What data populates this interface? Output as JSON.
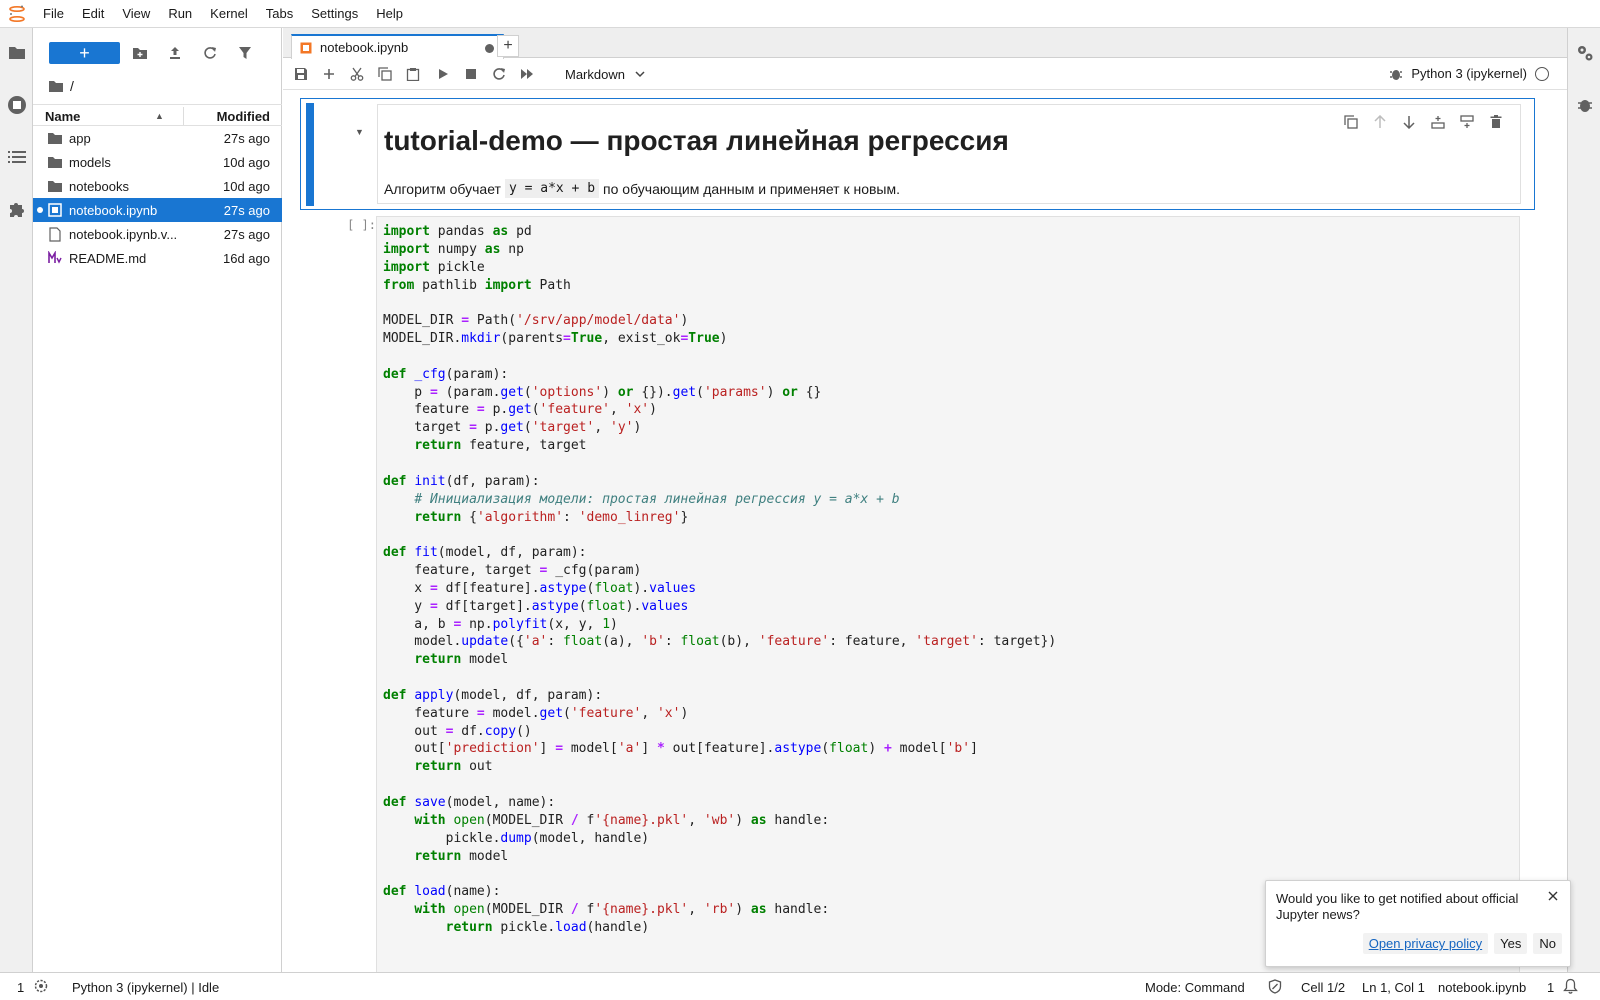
{
  "menubar": {
    "items": [
      "File",
      "Edit",
      "View",
      "Run",
      "Kernel",
      "Tabs",
      "Settings",
      "Help"
    ]
  },
  "filebrowser": {
    "new_label": "+",
    "breadcrumb": "/",
    "header": {
      "name": "Name",
      "modified": "Modified"
    },
    "rows": [
      {
        "name": "app",
        "modified": "27s ago",
        "icon": "folder-icon"
      },
      {
        "name": "models",
        "modified": "10d ago",
        "icon": "folder-icon"
      },
      {
        "name": "notebooks",
        "modified": "10d ago",
        "icon": "folder-icon"
      },
      {
        "name": "notebook.ipynb",
        "modified": "27s ago",
        "icon": "notebook-icon",
        "selected": true
      },
      {
        "name": "notebook.ipynb.v...",
        "modified": "27s ago",
        "icon": "file-icon"
      },
      {
        "name": "README.md",
        "modified": "16d ago",
        "icon": "markdown-icon"
      }
    ]
  },
  "tabs": {
    "active": "notebook.ipynb"
  },
  "toolbar": {
    "cell_type": "Markdown",
    "kernel_name": "Python 3 (ipykernel)"
  },
  "markdown_cell": {
    "title": "tutorial-demo — простая линейная регрессия",
    "text_before": "Алгоритм обучает",
    "code": "y = a*x + b",
    "text_after": "по обучающим данным и применяет к новым."
  },
  "code_cell": {
    "prompt": "[ ]:"
  },
  "toast": {
    "message": "Would you like to get notified about official Jupyter news?",
    "privacy_link": "Open privacy policy",
    "yes_label": "Yes",
    "no_label": "No"
  },
  "statusbar": {
    "left_count": "1",
    "kernel_status": "Python 3 (ipykernel) | Idle",
    "mode": "Mode: Command",
    "cell_position": "Cell 1/2",
    "cursor": "Ln 1, Col 1",
    "filename": "notebook.ipynb",
    "right_count": "1"
  },
  "colors": {
    "accent": "#1976d2",
    "keyword": "#008000",
    "string": "#ba2121",
    "operator": "#aa22ff",
    "comment": "#408080"
  }
}
